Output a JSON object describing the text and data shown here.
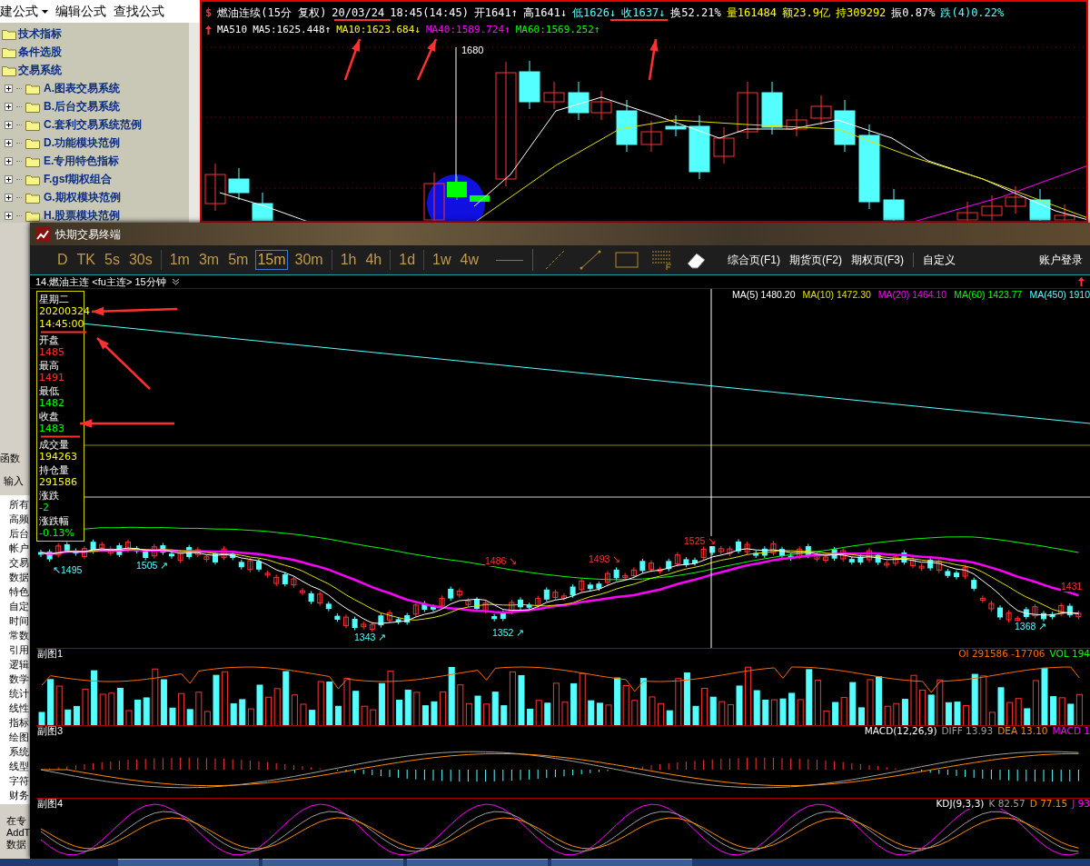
{
  "formula_menu": [
    {
      "label": "建公式",
      "dropdown": true
    },
    {
      "label": "编辑公式",
      "dropdown": false
    },
    {
      "label": "查找公式",
      "dropdown": false
    }
  ],
  "formula_tree": [
    {
      "label": "技术指标"
    },
    {
      "label": "条件选股"
    },
    {
      "label": "交易系统",
      "children": [
        {
          "label": "A.图表交易系统",
          "expanded": false
        },
        {
          "label": "B.后台交易系统",
          "expanded": false
        },
        {
          "label": "C.套利交易系统范例",
          "expanded": false
        },
        {
          "label": "D.功能模块范例",
          "expanded": false
        },
        {
          "label": "E.专用特色指标",
          "expanded": false
        },
        {
          "label": "F.gsf期权组合",
          "expanded": false
        },
        {
          "label": "G.期权模块范例",
          "expanded": false
        },
        {
          "label": "H.股票模块范例",
          "expanded": false
        }
      ]
    }
  ],
  "function_panel": {
    "tab": "函数",
    "input_label": "输入",
    "categories": [
      "所有",
      "高频",
      "后台",
      "帐户",
      "交易",
      "数据",
      "特色",
      "自定",
      "时间",
      "常数",
      "引用",
      "逻辑",
      "数学",
      "统计",
      "线性",
      "指标",
      "绘图",
      "系统",
      "线型",
      "字符",
      "财务"
    ],
    "footer_lines": [
      "在专",
      "AddT",
      "数据"
    ]
  },
  "back_chart": {
    "logo": "$",
    "title_items": [
      {
        "text": "燃油连续(15分 复权)",
        "color": "#ffffff"
      },
      {
        "text": "20/03/24",
        "color": "#ffffff"
      },
      {
        "text": "18:45(14:45)",
        "color": "#ffffff"
      },
      {
        "text": "开1641↑",
        "color": "#ffffff"
      },
      {
        "text": "高1641↓",
        "color": "#ffffff"
      },
      {
        "text": "低1626↓",
        "color": "#54ffff"
      },
      {
        "text": "收1637↓",
        "color": "#54ffff"
      },
      {
        "text": "换52.21%",
        "color": "#ffffff"
      },
      {
        "text": "量161484",
        "color": "#ffff00"
      },
      {
        "text": "额23.9亿",
        "color": "#ffff00"
      },
      {
        "text": "持309292",
        "color": "#ffff00"
      },
      {
        "text": "振0.87%",
        "color": "#ffffff"
      },
      {
        "text": "跌(4)0.22%",
        "color": "#54ffff"
      }
    ],
    "ma_items": [
      {
        "text": "MA510",
        "color": "#ffffff"
      },
      {
        "text": "MA5:1625.448↑",
        "color": "#ffffff"
      },
      {
        "text": "MA10:1623.684↓",
        "color": "#ffff00"
      },
      {
        "text": "MA40:1589.724↑",
        "color": "#ff00ff"
      },
      {
        "text": "MA60:1569.252↑",
        "color": "#00ff00"
      }
    ],
    "price_label": "1680"
  },
  "window": {
    "title": "快期交易终端",
    "period_groups": [
      [
        {
          "label": "D",
          "selected": false
        },
        {
          "label": "TK",
          "selected": false
        },
        {
          "label": "5s",
          "selected": false
        },
        {
          "label": "30s",
          "selected": false
        }
      ],
      [
        {
          "label": "1m",
          "selected": false
        },
        {
          "label": "3m",
          "selected": false
        },
        {
          "label": "5m",
          "selected": false
        },
        {
          "label": "15m",
          "selected": true
        },
        {
          "label": "30m",
          "selected": false
        }
      ],
      [
        {
          "label": "1h",
          "selected": false
        },
        {
          "label": "4h",
          "selected": false
        }
      ],
      [
        {
          "label": "1d",
          "selected": false
        }
      ],
      [
        {
          "label": "1w",
          "selected": false
        },
        {
          "label": "4w",
          "selected": false
        }
      ]
    ],
    "pages": [
      "综合页(F1)",
      "期货页(F2)",
      "期权页(F3)",
      "自定义"
    ],
    "account": "账户登录"
  },
  "chart_header": {
    "symbol": "14.燃油主连 <fu主连> 15分钟"
  },
  "ma_legend": [
    {
      "text": "MA(5) 1480.20",
      "color": "#ffffff"
    },
    {
      "text": "MA(10) 1472.30",
      "color": "#e0e000"
    },
    {
      "text": "MA(20) 1464.10",
      "color": "#ff00ff"
    },
    {
      "text": "MA(60) 1423.77",
      "color": "#00ff00"
    },
    {
      "text": "MA(450) 1910",
      "color": "#54ffff"
    }
  ],
  "info_panel": [
    {
      "label": "星期二",
      "value": "20200324",
      "color": "#ffff00"
    },
    {
      "value": "14:45:00",
      "color": "#ffff00"
    },
    {
      "label": "开盘",
      "value": "1485",
      "color": "#ff3232"
    },
    {
      "label": "最高",
      "value": "1491",
      "color": "#ff3232"
    },
    {
      "label": "最低",
      "value": "1482",
      "color": "#00ff00"
    },
    {
      "label": "收盘",
      "value": "1483",
      "color": "#00ff00"
    },
    {
      "label": "成交量",
      "value": "194263",
      "color": "#ffff00"
    },
    {
      "label": "持仓量",
      "value": "291586",
      "color": "#ffff00"
    },
    {
      "label": "涨跌",
      "value": "-2",
      "color": "#00ff00"
    },
    {
      "label": "涨跌幅",
      "value": "-0.13%",
      "color": "#00ff00"
    }
  ],
  "price_labels": [
    {
      "text": "↖1495",
      "kind": "low"
    },
    {
      "text": "1505 ↗",
      "kind": "low"
    },
    {
      "text": "1343 ↗",
      "kind": "low"
    },
    {
      "text": "1486 ↘",
      "kind": "high"
    },
    {
      "text": "1352 ↗",
      "kind": "low"
    },
    {
      "text": "1493 ↘",
      "kind": "high"
    },
    {
      "text": "1525 ↘",
      "kind": "high"
    },
    {
      "text": "1368 ↗",
      "kind": "low"
    },
    {
      "text": "1431",
      "kind": "high"
    }
  ],
  "sub_charts": [
    {
      "title": "副图1",
      "kind": "volume",
      "legend": [
        {
          "text": "OI 291586 -17706",
          "color": "#ff6a00"
        },
        {
          "text": "VOL 194",
          "color": "#00ff00"
        }
      ]
    },
    {
      "title": "副图3",
      "kind": "macd",
      "legend": [
        {
          "text": "MACD(12,26,9)",
          "color": "#ffffff"
        },
        {
          "text": "DIFF 13.93",
          "color": "#a0a0a0"
        },
        {
          "text": "DEA 13.10",
          "color": "#ff8c00"
        },
        {
          "text": "MACD 1",
          "color": "#ff00ff"
        }
      ]
    },
    {
      "title": "副图4",
      "kind": "kdj",
      "legend": [
        {
          "text": "KDJ(9,3,3)",
          "color": "#ffffff"
        },
        {
          "text": "K 82.57",
          "color": "#a0a0a0"
        },
        {
          "text": "D 77.15",
          "color": "#ff8c00"
        },
        {
          "text": "J 93",
          "color": "#ff00ff"
        }
      ]
    }
  ]
}
